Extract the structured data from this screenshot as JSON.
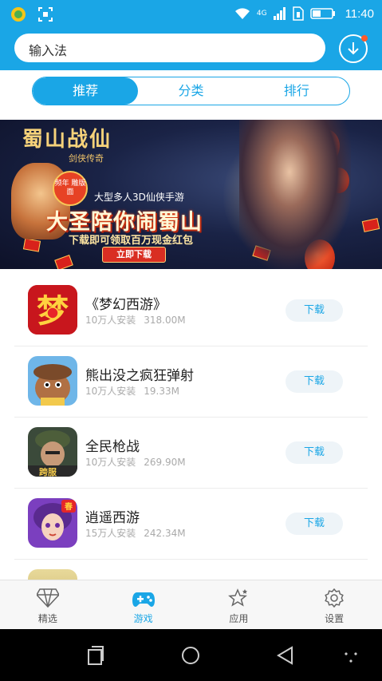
{
  "status_bar": {
    "time": "11:40",
    "network": "4G",
    "icons": [
      "app-notification-icon",
      "screenshot-icon",
      "wifi-icon",
      "signal-icon",
      "sim-icon",
      "battery-icon"
    ]
  },
  "search": {
    "value": "输入法"
  },
  "header": {
    "download_icon": "download-icon",
    "has_notification_dot": true
  },
  "tabs": [
    {
      "label": "推荐",
      "active": true
    },
    {
      "label": "分类",
      "active": false
    },
    {
      "label": "排行",
      "active": false
    }
  ],
  "banner": {
    "logo_text": "蜀山战仙",
    "logo_sub": "剑侠传奇",
    "badge": "频年 雕版面",
    "subtitle": "大型多人3D仙侠手游",
    "headline": "大圣陪你闹蜀山",
    "line": "下载即可领取百万现金红包",
    "button": "立即下载"
  },
  "apps": [
    {
      "name": "《梦幻西游》",
      "installs": "10万人安装",
      "size": "318.00M",
      "button": "下载",
      "icon": "menghuan-xiyou-game-icon"
    },
    {
      "name": "熊出没之疯狂弹射",
      "installs": "10万人安装",
      "size": "19.33M",
      "button": "下载",
      "icon": "xiong-chu-mo-game-icon"
    },
    {
      "name": "全民枪战",
      "installs": "10万人安装",
      "size": "269.90M",
      "button": "下载",
      "icon": "quanmin-qiangzhan-game-icon"
    },
    {
      "name": "逍遥西游",
      "installs": "15万人安装",
      "size": "242.34M",
      "button": "下载",
      "icon": "xiaoyao-xiyou-game-icon"
    }
  ],
  "bottom_nav": [
    {
      "label": "精选",
      "icon": "diamond-icon",
      "active": false
    },
    {
      "label": "游戏",
      "icon": "gamepad-icon",
      "active": true
    },
    {
      "label": "应用",
      "icon": "star-icon",
      "active": false
    },
    {
      "label": "设置",
      "icon": "gear-icon",
      "active": false
    }
  ],
  "system_nav": [
    "recent-apps-icon",
    "home-icon",
    "back-icon",
    "menu-dots-icon"
  ],
  "colors": {
    "accent": "#1aa6e6",
    "notification_dot": "#ff5a2a",
    "download_button_bg": "#eef4f8"
  }
}
